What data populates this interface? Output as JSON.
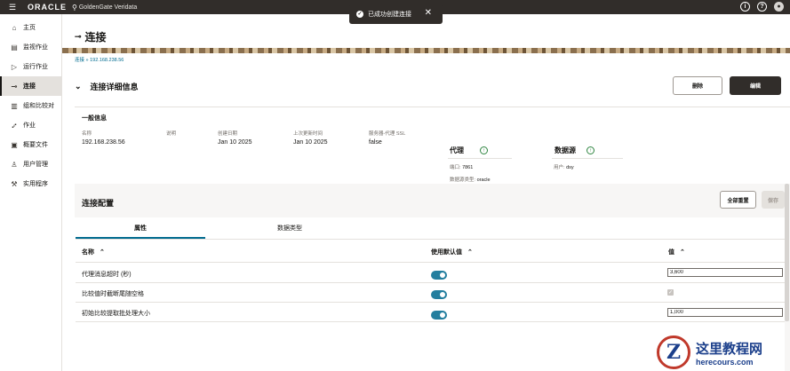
{
  "topbar": {
    "brand": "ORACLE",
    "product": "GoldenGate Veridata",
    "help_glyph": "?",
    "info_glyph": "i"
  },
  "toast": {
    "message": "已成功创建连接"
  },
  "sidebar": {
    "items": [
      {
        "label": "主页",
        "icon": "home-icon"
      },
      {
        "label": "监视作业",
        "icon": "monitor-icon"
      },
      {
        "label": "运行作业",
        "icon": "run-icon"
      },
      {
        "label": "连接",
        "icon": "connection-icon",
        "active": true
      },
      {
        "label": "组和比较对",
        "icon": "grid-icon"
      },
      {
        "label": "作业",
        "icon": "job-icon"
      },
      {
        "label": "概要文件",
        "icon": "profile-icon"
      },
      {
        "label": "用户管理",
        "icon": "users-icon"
      },
      {
        "label": "实用程序",
        "icon": "tools-icon"
      }
    ]
  },
  "page": {
    "title": "连接",
    "breadcrumb": "连接 » 192.168.238.56"
  },
  "details": {
    "heading": "连接详细信息",
    "delete_label": "删除",
    "edit_label": "编辑",
    "general_title": "一般信息",
    "fields": {
      "name_label": "名称",
      "name_value": "192.168.238.56",
      "desc_label": "说明",
      "desc_value": "",
      "created_label": "创建日期",
      "created_value": "Jan 10 2025",
      "updated_label": "上次更新时间",
      "updated_value": "Jan 10 2025",
      "ssl_label": "服务器-代理 SSL",
      "ssl_value": "false"
    },
    "agent": {
      "title": "代理",
      "port_label": "端口:",
      "port_value": "7861",
      "dbtype_label": "数据源类型:",
      "dbtype_value": "oracle"
    },
    "datasource": {
      "title": "数据源",
      "user_label": "用户:",
      "user_value": "dsy"
    }
  },
  "config": {
    "heading": "连接配置",
    "reset_label": "全部重置",
    "save_label": "保存",
    "tabs": [
      "属性",
      "数据类型"
    ],
    "columns": {
      "name": "名称",
      "default": "使用默认值",
      "value": "值"
    },
    "rows": [
      {
        "name": "代理消息超时 (秒)",
        "use_default": true,
        "value": "3,600"
      },
      {
        "name": "比较值时截断尾随空格",
        "use_default": true,
        "value": "checked"
      },
      {
        "name": "初始比较提取批处理大小",
        "use_default": true,
        "value": "1,000"
      }
    ],
    "sort_glyph": "⌃"
  },
  "watermark": {
    "badge": "Z",
    "title": "这里教程网",
    "url": "herecours.com"
  },
  "colors": {
    "topbar": "#312d2a",
    "accent": "#227e9e",
    "success": "#2e8540",
    "link": "#006b8f"
  }
}
